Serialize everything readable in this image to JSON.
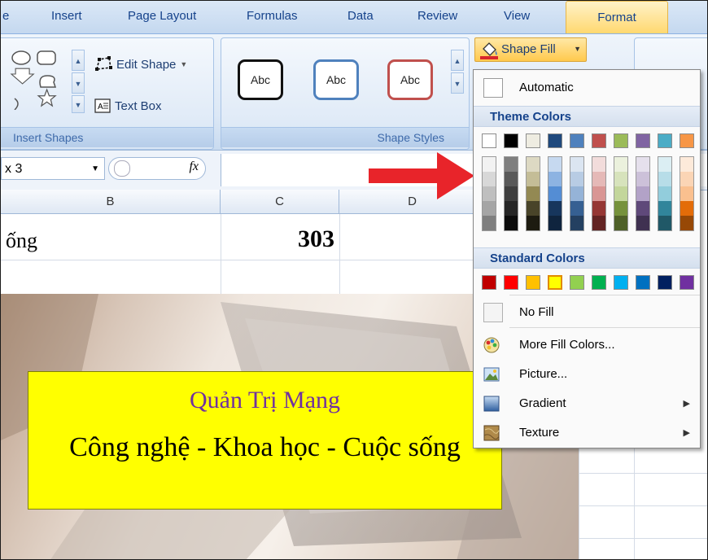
{
  "tabs": [
    "e",
    "Insert",
    "Page Layout",
    "Formulas",
    "Data",
    "Review",
    "View",
    "Format"
  ],
  "ribbon": {
    "insert_shapes": {
      "edit_shape_label": "Edit Shape",
      "text_box_label": "Text Box",
      "group_label": "Insert Shapes"
    },
    "shape_styles": {
      "style_samples": [
        "Abc",
        "Abc",
        "Abc"
      ],
      "group_label": "Shape Styles"
    },
    "shape_fill_label": "Shape Fill"
  },
  "formula_bar": {
    "name_box": "x 3",
    "fx_label": "fx"
  },
  "sheet": {
    "columns": [
      "B",
      "C",
      "D"
    ],
    "cell_b": "ống",
    "cell_c": "303"
  },
  "textbox": {
    "line1": "Quản Trị Mạng",
    "line2": "Công nghệ - Khoa học - Cuộc sống",
    "line1_color": "#7030a0"
  },
  "menu": {
    "automatic_label": "Automatic",
    "theme_colors_label": "Theme Colors",
    "standard_colors_label": "Standard Colors",
    "theme_top_row": [
      "#ffffff",
      "#000000",
      "#eeece1",
      "#1f497d",
      "#4f81bd",
      "#c0504d",
      "#9bbb59",
      "#8064a2",
      "#4bacc6",
      "#f79646"
    ],
    "theme_shades": [
      [
        "#f2f2f2",
        "#d8d8d8",
        "#bfbfbf",
        "#a5a5a5",
        "#7f7f7f"
      ],
      [
        "#7f7f7f",
        "#595959",
        "#3f3f3f",
        "#262626",
        "#0c0c0c"
      ],
      [
        "#ddd9c3",
        "#c4bd97",
        "#938953",
        "#494429",
        "#1d1b10"
      ],
      [
        "#c6d9f0",
        "#8db3e2",
        "#548dd4",
        "#17365d",
        "#0f243e"
      ],
      [
        "#dbe5f1",
        "#b8cce4",
        "#95b3d7",
        "#366092",
        "#244061"
      ],
      [
        "#f2dcdb",
        "#e5b9b7",
        "#d99694",
        "#953734",
        "#632423"
      ],
      [
        "#ebf1dd",
        "#d7e3bc",
        "#c3d69b",
        "#76923c",
        "#4f6128"
      ],
      [
        "#e5e0ec",
        "#ccc1d9",
        "#b2a2c7",
        "#5f497a",
        "#3f3151"
      ],
      [
        "#dbeef3",
        "#b7dde8",
        "#92cddc",
        "#31859b",
        "#205867"
      ],
      [
        "#fdeada",
        "#fbd5b5",
        "#fac08f",
        "#e36c09",
        "#974806"
      ]
    ],
    "standard_colors": [
      "#c00000",
      "#ff0000",
      "#ffc000",
      "#ffff00",
      "#92d050",
      "#00b050",
      "#00b0f0",
      "#0070c0",
      "#002060",
      "#7030a0"
    ],
    "items": {
      "no_fill": "No Fill",
      "more_fill_colors": "More Fill Colors...",
      "picture": "Picture...",
      "gradient": "Gradient",
      "texture": "Texture"
    }
  },
  "accents": {
    "arrow_color": "#e8242a",
    "highlight_yellow": "#ffff00"
  }
}
